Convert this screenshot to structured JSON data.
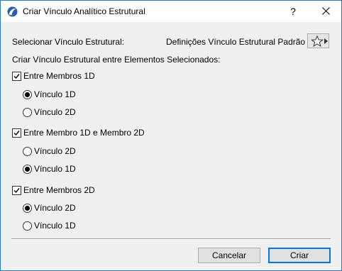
{
  "window": {
    "title": "Criar Vínculo Analítico Estrutural",
    "help_label": "?"
  },
  "select_link": {
    "label": "Selecionar Vínculo Estrutural:",
    "value": "Definições Vínculo Estrutural Padrão"
  },
  "section_label": "Criar Vínculo Estrutural entre Elementos Selecionados:",
  "groups": [
    {
      "label": "Entre Membros 1D",
      "checked": true,
      "options": [
        {
          "label": "Vínculo 1D",
          "selected": true
        },
        {
          "label": "Vínculo 2D",
          "selected": false
        }
      ]
    },
    {
      "label": "Entre Membro 1D e Membro 2D",
      "checked": true,
      "options": [
        {
          "label": "Vínculo 2D",
          "selected": false
        },
        {
          "label": "Vínculo 1D",
          "selected": true
        }
      ]
    },
    {
      "label": "Entre Membros 2D",
      "checked": true,
      "options": [
        {
          "label": "Vínculo 2D",
          "selected": true
        },
        {
          "label": "Vínculo 1D",
          "selected": false
        }
      ]
    }
  ],
  "buttons": {
    "cancel": "Cancelar",
    "ok": "Criar"
  }
}
